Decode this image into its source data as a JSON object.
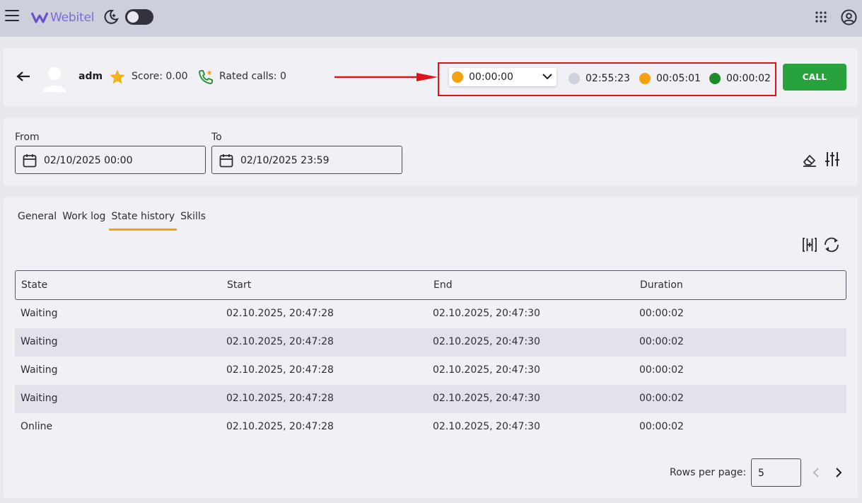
{
  "app": {
    "name": "Webitel"
  },
  "topbar": {
    "menu_icon": "hamburger-icon",
    "theme_icon": "moon-icon",
    "apps_icon": "grid-icon",
    "account_icon": "user-circle-icon"
  },
  "agent": {
    "name": "adm",
    "score": "Score: 0.00",
    "rated_calls": "Rated calls: 0"
  },
  "status": {
    "selected_time": "00:00:00",
    "selected_color": "#f4a20d",
    "timers": [
      {
        "time": "02:55:23",
        "color": "#cfd1dc"
      },
      {
        "time": "00:05:01",
        "color": "#f4a20d"
      },
      {
        "time": "00:00:02",
        "color": "#1e8c2a"
      }
    ]
  },
  "call_button": "CALL",
  "filters": {
    "from_label": "From",
    "from_value": "02/10/2025 00:00",
    "to_label": "To",
    "to_value": "02/10/2025 23:59"
  },
  "tabs": [
    "General",
    "Work log",
    "State history",
    "Skills"
  ],
  "active_tab": "State history",
  "table": {
    "headers": [
      "State",
      "Start",
      "End",
      "Duration"
    ],
    "rows": [
      [
        "Waiting",
        "02.10.2025, 20:47:28",
        "02.10.2025, 20:47:30",
        "00:00:02"
      ],
      [
        "Waiting",
        "02.10.2025, 20:47:28",
        "02.10.2025, 20:47:30",
        "00:00:02"
      ],
      [
        "Waiting",
        "02.10.2025, 20:47:28",
        "02.10.2025, 20:47:30",
        "00:00:02"
      ],
      [
        "Waiting",
        "02.10.2025, 20:47:28",
        "02.10.2025, 20:47:30",
        "00:00:02"
      ],
      [
        "Online",
        "02.10.2025, 20:47:28",
        "02.10.2025, 20:47:30",
        "00:00:02"
      ]
    ]
  },
  "pagination": {
    "rows_per_page_label": "Rows per page:",
    "rows_per_page": "5"
  },
  "colors": {
    "accent": "#f4a20d",
    "call": "#27a23d",
    "highlight": "#e0121a"
  }
}
